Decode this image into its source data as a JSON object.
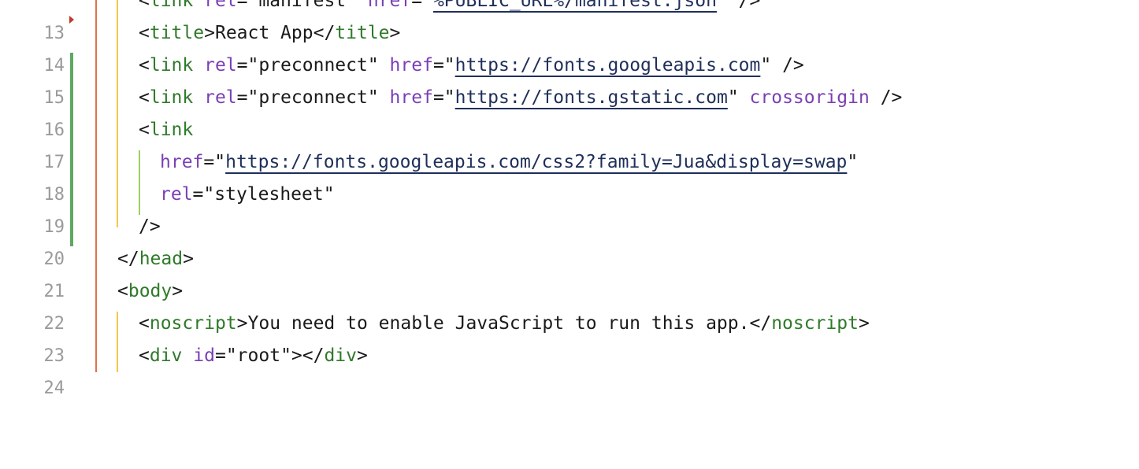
{
  "editor": {
    "lines": [
      {
        "number": "13",
        "tokens": [
          {
            "t": "punct",
            "v": "<"
          },
          {
            "t": "tag",
            "v": "link"
          },
          {
            "t": "punct",
            "v": " "
          },
          {
            "t": "attr",
            "v": "rel"
          },
          {
            "t": "punct",
            "v": "=\""
          },
          {
            "t": "str",
            "v": "manifest"
          },
          {
            "t": "punct",
            "v": "\" "
          },
          {
            "t": "attr",
            "v": "href"
          },
          {
            "t": "punct",
            "v": "=\""
          },
          {
            "t": "url",
            "v": "%PUBLIC_URL%/manifest.json"
          },
          {
            "t": "punct",
            "v": "\" />"
          }
        ]
      },
      {
        "number": "14",
        "tokens": [
          {
            "t": "punct",
            "v": "<"
          },
          {
            "t": "tag",
            "v": "title"
          },
          {
            "t": "punct",
            "v": ">"
          },
          {
            "t": "text",
            "v": "React App"
          },
          {
            "t": "punct",
            "v": "</"
          },
          {
            "t": "tag",
            "v": "title"
          },
          {
            "t": "punct",
            "v": ">"
          }
        ]
      },
      {
        "number": "15",
        "tokens": [
          {
            "t": "punct",
            "v": "<"
          },
          {
            "t": "tag",
            "v": "link"
          },
          {
            "t": "punct",
            "v": " "
          },
          {
            "t": "attr",
            "v": "rel"
          },
          {
            "t": "punct",
            "v": "=\""
          },
          {
            "t": "str",
            "v": "preconnect"
          },
          {
            "t": "punct",
            "v": "\" "
          },
          {
            "t": "attr",
            "v": "href"
          },
          {
            "t": "punct",
            "v": "=\""
          },
          {
            "t": "url",
            "v": "https://fonts.googleapis.com"
          },
          {
            "t": "punct",
            "v": "\" />"
          }
        ]
      },
      {
        "number": "16",
        "tokens": [
          {
            "t": "punct",
            "v": "<"
          },
          {
            "t": "tag",
            "v": "link"
          },
          {
            "t": "punct",
            "v": " "
          },
          {
            "t": "attr",
            "v": "rel"
          },
          {
            "t": "punct",
            "v": "=\""
          },
          {
            "t": "str",
            "v": "preconnect"
          },
          {
            "t": "punct",
            "v": "\" "
          },
          {
            "t": "attr",
            "v": "href"
          },
          {
            "t": "punct",
            "v": "=\""
          },
          {
            "t": "url",
            "v": "https://fonts.gstatic.com"
          },
          {
            "t": "punct",
            "v": "\" "
          },
          {
            "t": "attr",
            "v": "crossorigin"
          },
          {
            "t": "punct",
            "v": " />"
          }
        ]
      },
      {
        "number": "17",
        "tokens": [
          {
            "t": "punct",
            "v": "<"
          },
          {
            "t": "tag",
            "v": "link"
          }
        ]
      },
      {
        "number": "18",
        "tokens": [
          {
            "t": "attr",
            "v": "href"
          },
          {
            "t": "punct",
            "v": "=\""
          },
          {
            "t": "url",
            "v": "https://fonts.googleapis.com/css2?family=Jua&display=swap"
          },
          {
            "t": "punct",
            "v": "\""
          }
        ]
      },
      {
        "number": "19",
        "tokens": [
          {
            "t": "attr",
            "v": "rel"
          },
          {
            "t": "punct",
            "v": "=\""
          },
          {
            "t": "str",
            "v": "stylesheet"
          },
          {
            "t": "punct",
            "v": "\""
          }
        ]
      },
      {
        "number": "20",
        "tokens": [
          {
            "t": "punct",
            "v": "/>"
          }
        ]
      },
      {
        "number": "21",
        "tokens": [
          {
            "t": "punct",
            "v": "</"
          },
          {
            "t": "tag",
            "v": "head"
          },
          {
            "t": "punct",
            "v": ">"
          }
        ]
      },
      {
        "number": "22",
        "tokens": [
          {
            "t": "punct",
            "v": "<"
          },
          {
            "t": "tag",
            "v": "body"
          },
          {
            "t": "punct",
            "v": ">"
          }
        ]
      },
      {
        "number": "23",
        "tokens": [
          {
            "t": "punct",
            "v": "<"
          },
          {
            "t": "tag",
            "v": "noscript"
          },
          {
            "t": "punct",
            "v": ">"
          },
          {
            "t": "text",
            "v": "You need to enable JavaScript to run this app."
          },
          {
            "t": "punct",
            "v": "</"
          },
          {
            "t": "tag",
            "v": "noscript"
          },
          {
            "t": "punct",
            "v": ">"
          }
        ]
      },
      {
        "number": "24",
        "tokens": [
          {
            "t": "punct",
            "v": "<"
          },
          {
            "t": "tag",
            "v": "div"
          },
          {
            "t": "punct",
            "v": " "
          },
          {
            "t": "attr",
            "v": "id"
          },
          {
            "t": "punct",
            "v": "=\""
          },
          {
            "t": "str",
            "v": "root"
          },
          {
            "t": "punct",
            "v": "\"></"
          },
          {
            "t": "tag",
            "v": "div"
          },
          {
            "t": "punct",
            "v": ">"
          }
        ]
      }
    ],
    "modified_lines": [
      "15",
      "16",
      "17",
      "18",
      "19",
      "20"
    ]
  },
  "colors": {
    "tag": "#2f7a2a",
    "attribute": "#7a3fb5",
    "url": "#1f2f5a",
    "text": "#1a1a1a",
    "line_number": "#9a9a9a",
    "change_bar": "#5fa862",
    "guide_html": "#e0744a",
    "guide_head": "#f1c84b",
    "guide_link": "#9ccf5e"
  }
}
